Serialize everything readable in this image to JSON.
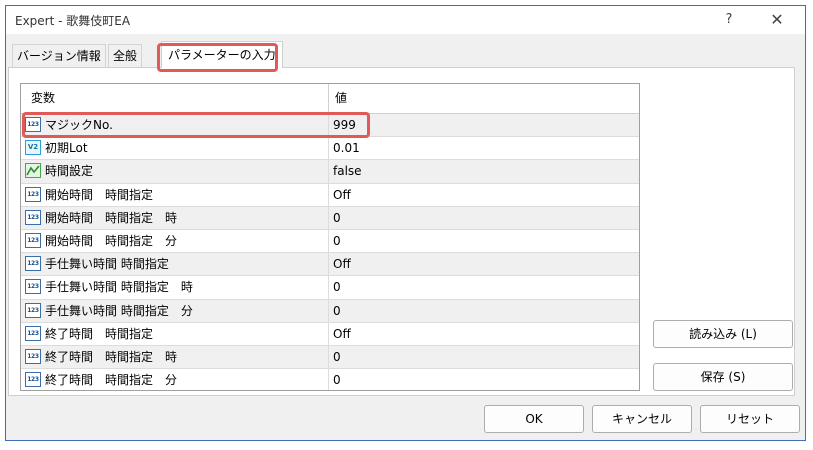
{
  "window": {
    "title": "Expert - 歌舞伎町EA",
    "help_label": "?",
    "close_label": "✕"
  },
  "tabs": [
    {
      "label": "バージョン情報",
      "active": false
    },
    {
      "label": "全般",
      "active": false
    },
    {
      "label": "パラメーターの入力",
      "active": true
    }
  ],
  "grid": {
    "col_variable": "変数",
    "col_value": "値",
    "rows": [
      {
        "icon": "integer-icon",
        "icon_text": "123",
        "name": "マジックNo.",
        "value": "999"
      },
      {
        "icon": "double-icon",
        "icon_text": "V2",
        "name": "初期Lot",
        "value": "0.01"
      },
      {
        "icon": "bool-icon",
        "icon_text": "",
        "name": "時間設定",
        "value": "false"
      },
      {
        "icon": "integer-icon",
        "icon_text": "123",
        "name": "開始時間　時間指定",
        "value": "Off"
      },
      {
        "icon": "integer-icon",
        "icon_text": "123",
        "name": "開始時間　時間指定　時",
        "value": "0"
      },
      {
        "icon": "integer-icon",
        "icon_text": "123",
        "name": "開始時間　時間指定　分",
        "value": "0"
      },
      {
        "icon": "integer-icon",
        "icon_text": "123",
        "name": "手仕舞い時間 時間指定",
        "value": "Off"
      },
      {
        "icon": "integer-icon",
        "icon_text": "123",
        "name": "手仕舞い時間 時間指定　時",
        "value": "0"
      },
      {
        "icon": "integer-icon",
        "icon_text": "123",
        "name": "手仕舞い時間 時間指定　分",
        "value": "0"
      },
      {
        "icon": "integer-icon",
        "icon_text": "123",
        "name": "終了時間　時間指定",
        "value": "Off"
      },
      {
        "icon": "integer-icon",
        "icon_text": "123",
        "name": "終了時間　時間指定　時",
        "value": "0"
      },
      {
        "icon": "integer-icon",
        "icon_text": "123",
        "name": "終了時間　時間指定　分",
        "value": "0"
      }
    ]
  },
  "side_buttons": {
    "load": "読み込み (L)",
    "save": "保存 (S)"
  },
  "bottom_buttons": {
    "ok": "OK",
    "cancel": "キャンセル",
    "reset": "リセット"
  },
  "colors": {
    "highlight": "#e05a5a",
    "window_border": "#3c6fb5",
    "alt_row": "#f0f0f0"
  }
}
